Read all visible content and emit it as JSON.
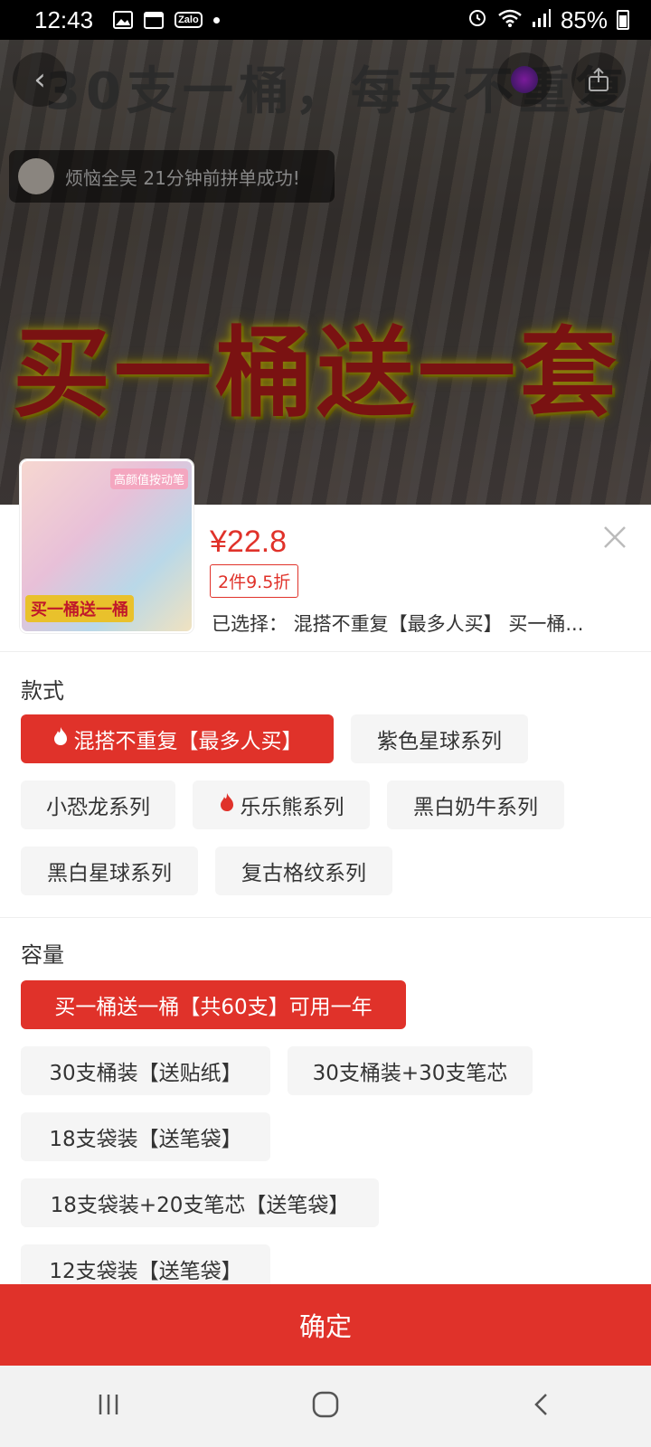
{
  "status_bar": {
    "time": "12:43",
    "battery": "85%"
  },
  "hero": {
    "headline": "30支一桶，每支不重复",
    "promo": "买一桶送一套",
    "toast": "烦恼全吴 21分钟前拼单成功!"
  },
  "product": {
    "thumb_top": "高颜值按动笔",
    "thumb_bottom": "买一桶送一桶",
    "price": "¥22.8",
    "discount": "2件9.5折",
    "selected": "已选择： 混搭不重复【最多人买】 买一桶..."
  },
  "styles": {
    "title": "款式",
    "options": [
      {
        "label": "混搭不重复【最多人买】",
        "selected": true,
        "hot": true
      },
      {
        "label": "紫色星球系列",
        "selected": false,
        "hot": false
      },
      {
        "label": "小恐龙系列",
        "selected": false,
        "hot": false
      },
      {
        "label": "乐乐熊系列",
        "selected": false,
        "hot": true
      },
      {
        "label": "黑白奶牛系列",
        "selected": false,
        "hot": false
      },
      {
        "label": "黑白星球系列",
        "selected": false,
        "hot": false
      },
      {
        "label": "复古格纹系列",
        "selected": false,
        "hot": false
      }
    ]
  },
  "capacity": {
    "title": "容量",
    "options": [
      {
        "label": "买一桶送一桶【共60支】可用一年",
        "selected": true
      },
      {
        "label": "30支桶装【送贴纸】",
        "selected": false
      },
      {
        "label": "30支桶装+30支笔芯",
        "selected": false
      },
      {
        "label": "18支袋装【送笔袋】",
        "selected": false
      },
      {
        "label": "18支袋装+20支笔芯【送笔袋】",
        "selected": false
      },
      {
        "label": "12支袋装【送笔袋】",
        "selected": false
      }
    ]
  },
  "confirm_label": "确定",
  "colors": {
    "accent": "#e0322a"
  }
}
